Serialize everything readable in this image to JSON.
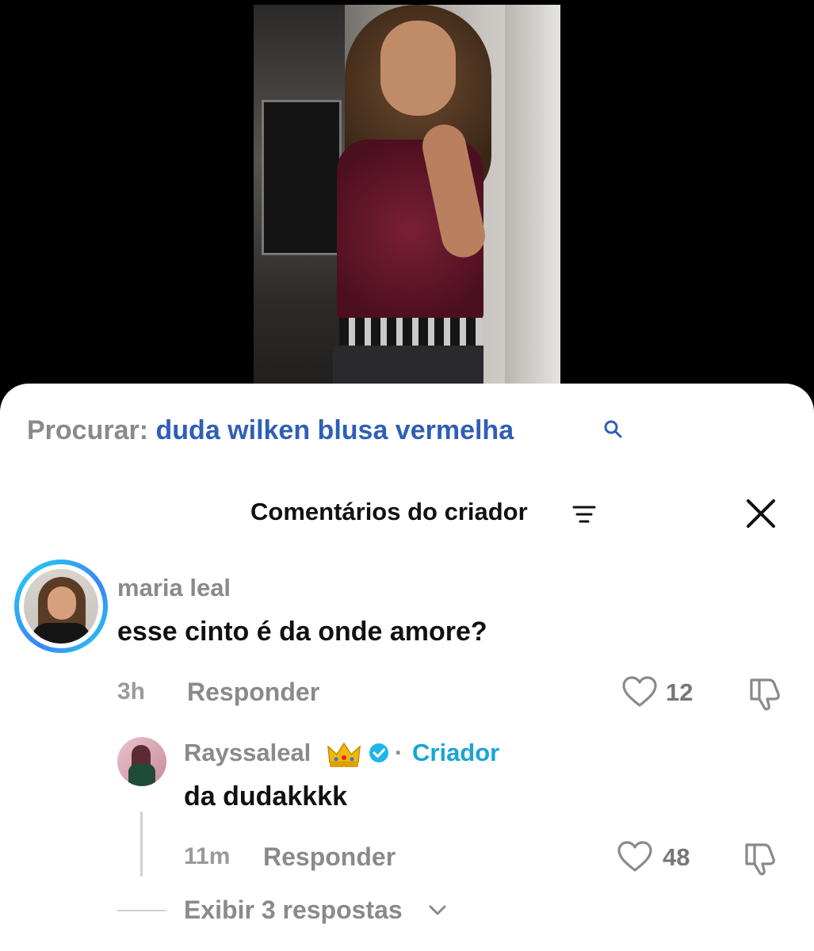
{
  "search": {
    "prefix": "Procurar:",
    "query": "duda wilken blusa vermelha"
  },
  "header": {
    "title": "Comentários do criador"
  },
  "comments": [
    {
      "username": "maria leal",
      "text": "esse cinto é da onde amore?",
      "time": "3h",
      "reply_label": "Responder",
      "likes": "12"
    },
    {
      "username": "Rayssaleal",
      "badge": "Criador",
      "separator": "·",
      "text": "da dudakkkk",
      "time": "11m",
      "reply_label": "Responder",
      "likes": "48"
    }
  ],
  "view_replies": "Exibir 3 respostas",
  "colors": {
    "search_query": "#2f5fb5",
    "creator_badge": "#1aa4d6",
    "verified": "#20b5e8",
    "avatar_ring": "#22d3ee"
  },
  "icons": [
    "search-icon",
    "filter-icon",
    "close-icon",
    "heart-icon",
    "dislike-icon",
    "crown-icon",
    "verified-icon",
    "chevron-down-icon"
  ]
}
